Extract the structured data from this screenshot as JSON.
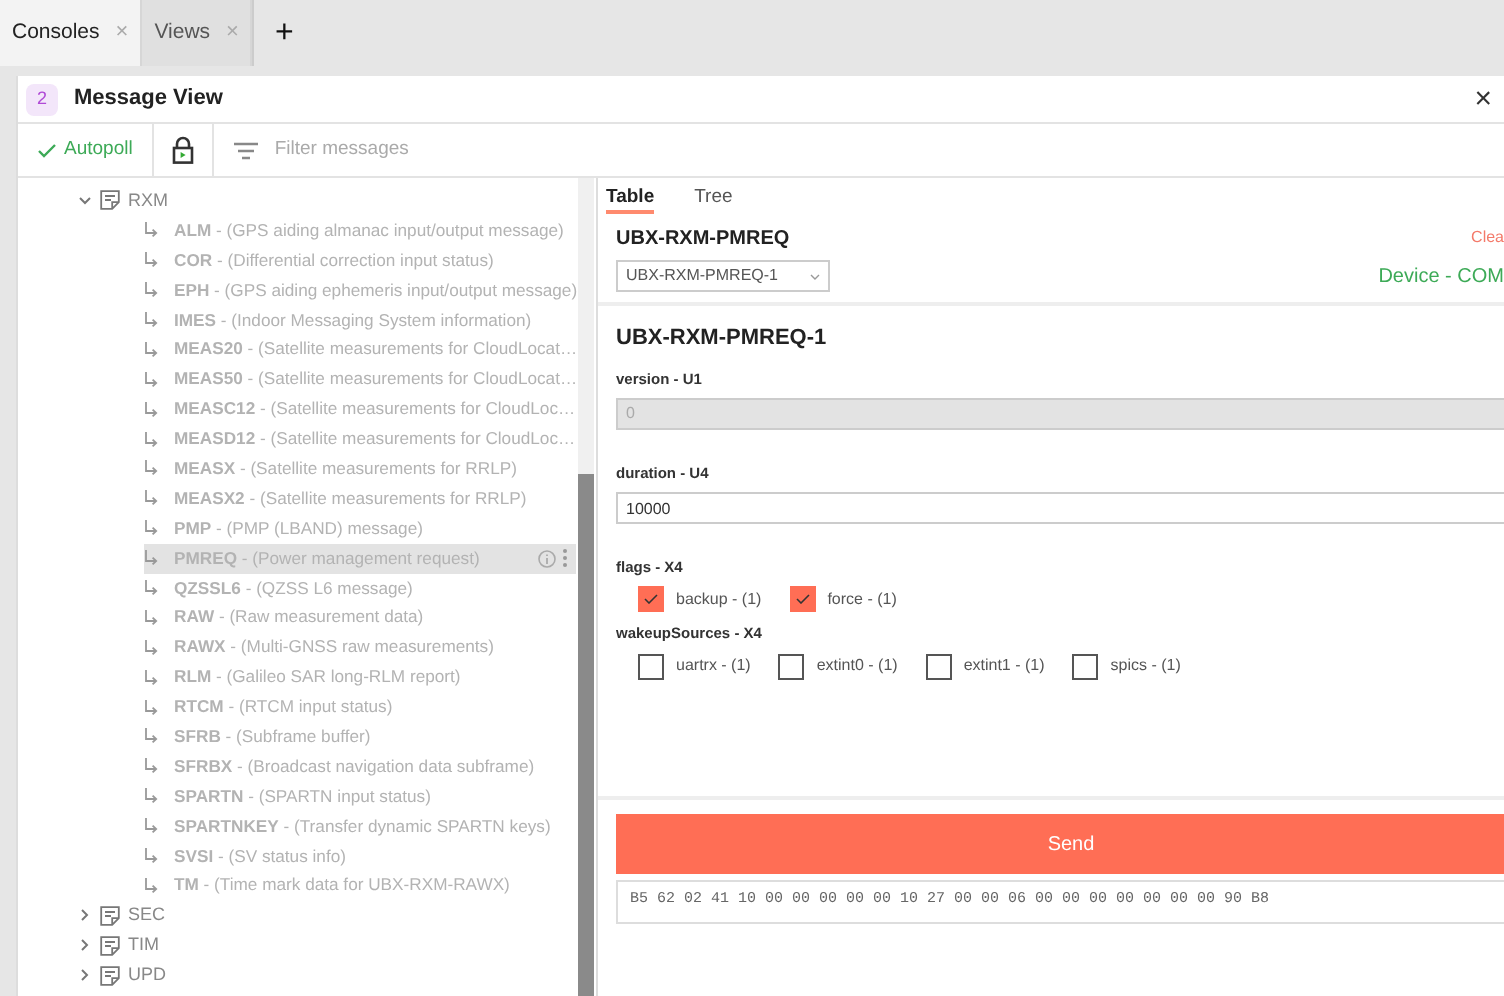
{
  "tabs": [
    {
      "label": "Consoles",
      "close": "×",
      "selected": true
    },
    {
      "label": "Views",
      "close": "×",
      "selected": false
    }
  ],
  "add_tab": "+",
  "panel": {
    "badge": "2",
    "title": "Message View",
    "close": "×"
  },
  "toolbar": {
    "autopoll": "Autopoll",
    "autopoll_on": true,
    "filter_placeholder": "Filter messages"
  },
  "tree": [
    {
      "label": "RXM",
      "expanded": true,
      "children": [
        {
          "text": "**ALM** - (GPS aiding almanac input/output message)",
          "selected": false
        },
        {
          "text": "**COR** - (Differential correction input status)",
          "selected": false
        },
        {
          "text": "**EPH** - (GPS aiding ephemeris input/output message)",
          "selected": false
        },
        {
          "text": "**IMES** - (Indoor Messaging System information)",
          "selected": false
        },
        {
          "text": "**MEAS20** - (Satellite measurements for CloudLocat…",
          "selected": false
        },
        {
          "text": "**MEAS50** - (Satellite measurements for CloudLocat…",
          "selected": false
        },
        {
          "text": "**MEASC12** - (Satellite measurements for CloudLoc…",
          "selected": false
        },
        {
          "text": "**MEASD12** - (Satellite measurements for CloudLoc…",
          "selected": false
        },
        {
          "text": "**MEASX** - (Satellite measurements for RRLP)",
          "selected": false
        },
        {
          "text": "**MEASX2** - (Satellite measurements for RRLP)",
          "selected": false
        },
        {
          "text": "**PMP** - (PMP (LBAND) message)",
          "selected": false
        },
        {
          "text": "**PMREQ** - (Power management request)",
          "selected": true
        },
        {
          "text": "**QZSSL6** - (QZSS L6 message)",
          "selected": false
        },
        {
          "text": "**RAW** - (Raw measurement data)",
          "selected": false
        },
        {
          "text": "**RAWX** - (Multi-GNSS raw measurements)",
          "selected": false
        },
        {
          "text": "**RLM** - (Galileo SAR long-RLM report)",
          "selected": false
        },
        {
          "text": "**RTCM** - (RTCM input status)",
          "selected": false
        },
        {
          "text": "**SFRB** - (Subframe buffer)",
          "selected": false
        },
        {
          "text": "**SFRBX** - (Broadcast navigation data subframe)",
          "selected": false
        },
        {
          "text": "**SPARTN** - (SPARTN input status)",
          "selected": false
        },
        {
          "text": "**SPARTNKEY** - (Transfer dynamic SPARTN keys)",
          "selected": false
        },
        {
          "text": "**SVSI** - (SV status info)",
          "selected": false
        },
        {
          "text": "**TM** - (Time mark data for UBX-RXM-RAWX)",
          "selected": false
        }
      ]
    },
    {
      "label": "SEC",
      "expanded": false
    },
    {
      "label": "TIM",
      "expanded": false
    },
    {
      "label": "UPD",
      "expanded": false
    }
  ],
  "view_tabs": [
    {
      "label": "Table",
      "selected": true
    },
    {
      "label": "Tree",
      "selected": false
    }
  ],
  "message": {
    "name": "UBX-RXM-PMREQ",
    "clear": "Clea",
    "select": "UBX-RXM-PMREQ-1",
    "device": "Device - COM"
  },
  "form": {
    "title": "UBX-RXM-PMREQ-1",
    "fields": [
      {
        "kind": "input",
        "label": "version - U1",
        "value": "0",
        "disabled": true
      },
      {
        "kind": "input",
        "label": "duration - U4",
        "value": "10000",
        "disabled": false
      },
      {
        "kind": "flags",
        "label": "flags - X4",
        "options": [
          {
            "label": "backup - (1)",
            "checked": true
          },
          {
            "label": "force - (1)",
            "checked": true
          }
        ]
      },
      {
        "kind": "flags",
        "label": "wakeupSources - X4",
        "options": [
          {
            "label": "uartrx - (1)",
            "checked": false
          },
          {
            "label": "extint0 - (1)",
            "checked": false
          },
          {
            "label": "extint1 - (1)",
            "checked": false
          },
          {
            "label": "spics - (1)",
            "checked": false
          }
        ]
      }
    ]
  },
  "send": "Send",
  "hex": "B5 62 02 41 10 00 00 00 00 00 10 27 00 00 06 00 00 00 00 00 00 00 90 B8"
}
